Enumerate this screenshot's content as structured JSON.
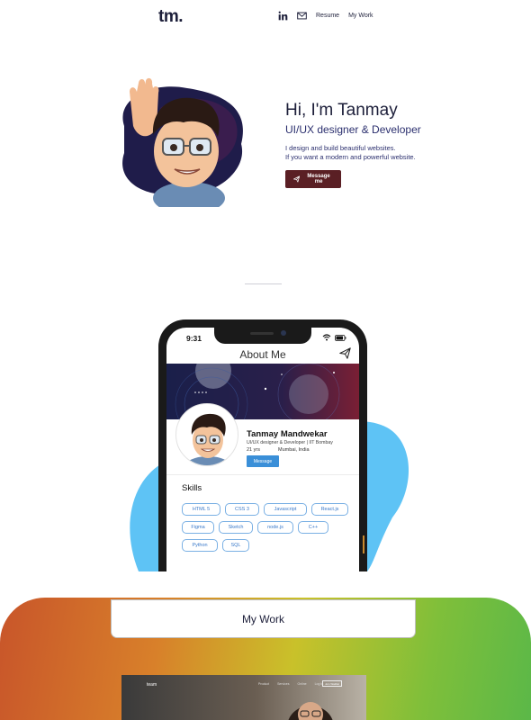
{
  "header": {
    "logo": "tm.",
    "nav": [
      {
        "type": "icon",
        "name": "linkedin-icon"
      },
      {
        "type": "icon",
        "name": "mail-icon"
      },
      {
        "type": "link",
        "label": "Resume"
      },
      {
        "type": "link",
        "label": "My Work"
      }
    ],
    "resume_label": "Resume",
    "work_label": "My Work"
  },
  "hero": {
    "title": "Hi, I'm Tanmay",
    "subtitle": "UI/UX designer & Developer",
    "line1": "I design and build beautiful websites.",
    "line2": "If you want a modern and powerful website.",
    "button_label": "Message me",
    "button_icon": "send-icon"
  },
  "phone": {
    "time": "9:31",
    "title": "About Me",
    "name": "Tanmay Mandwekar",
    "role": "UI/UX designer & Developer | IIT Bombay",
    "age": "21 yrs",
    "location": "Mumbai, India",
    "button_label": "Message",
    "skills_title": "Skills",
    "skills": [
      "HTML 5",
      "CSS 3",
      "Javascript",
      "React.js",
      "Figma",
      "Sketch",
      "node.js",
      "C++",
      "Python",
      "SQL"
    ]
  },
  "work": {
    "title": "My Work",
    "preview": {
      "logo": "team",
      "nav": [
        "Product",
        "Services",
        "Online",
        "Log In"
      ],
      "cta": "Join Waitlist"
    }
  },
  "colors": {
    "primary_text": "#1d1f3a",
    "message_button": "#5a1f24",
    "accent_blue": "#3a8fd8",
    "blob": "#5ec3f5"
  }
}
